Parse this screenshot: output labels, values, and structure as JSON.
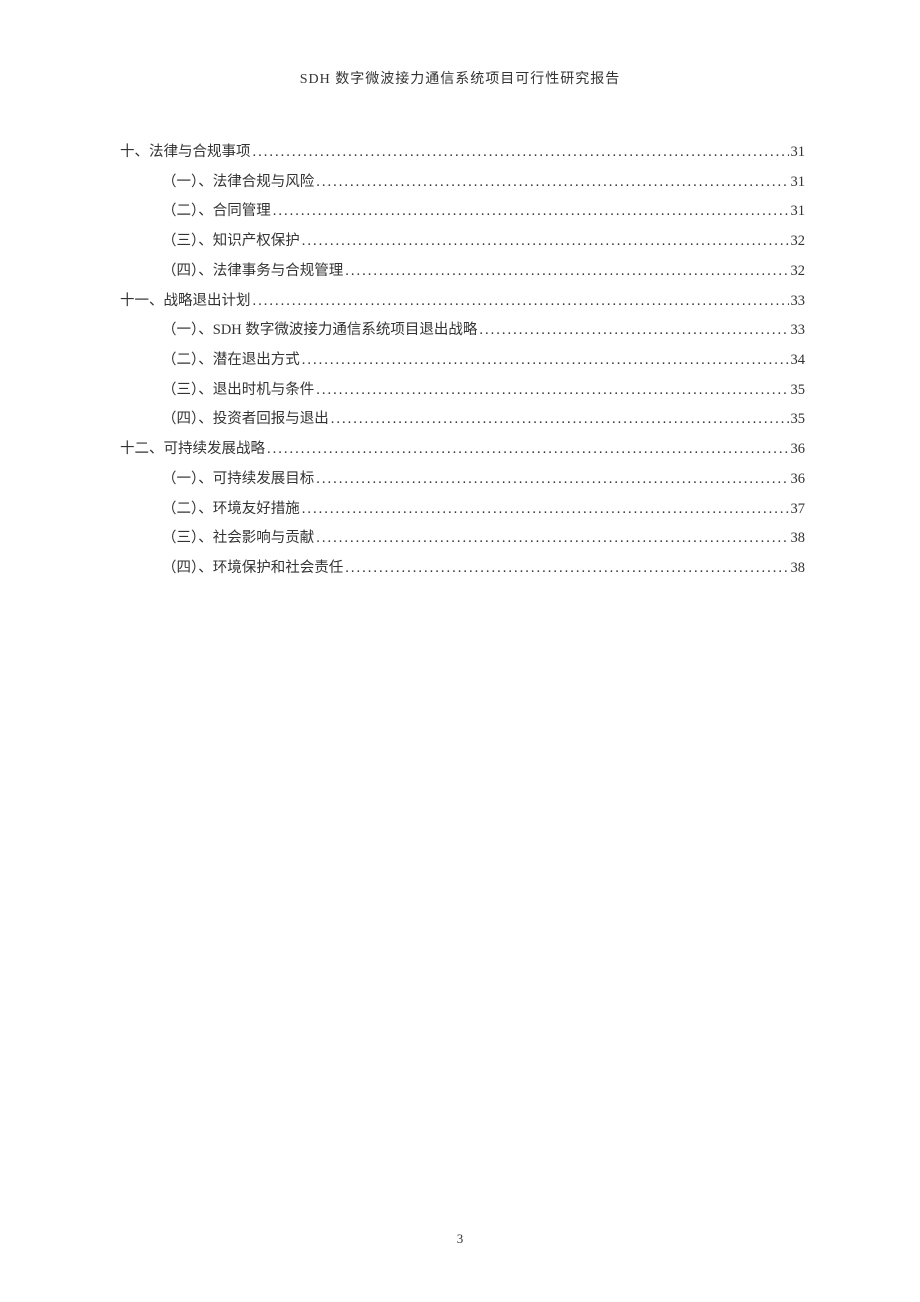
{
  "header": {
    "title": "SDH 数字微波接力通信系统项目可行性研究报告"
  },
  "toc": [
    {
      "level": 1,
      "label": "十、法律与合规事项",
      "page": "31"
    },
    {
      "level": 2,
      "label": "（一）、法律合规与风险",
      "page": "31"
    },
    {
      "level": 2,
      "label": "（二）、合同管理",
      "page": "31"
    },
    {
      "level": 2,
      "label": "（三）、知识产权保护",
      "page": "32"
    },
    {
      "level": 2,
      "label": "（四）、法律事务与合规管理",
      "page": "32"
    },
    {
      "level": 1,
      "label": "十一、战略退出计划",
      "page": "33"
    },
    {
      "level": 2,
      "label": "（一）、SDH 数字微波接力通信系统项目退出战略",
      "page": "33"
    },
    {
      "level": 2,
      "label": "（二）、潜在退出方式",
      "page": "34"
    },
    {
      "level": 2,
      "label": "（三）、退出时机与条件",
      "page": "35"
    },
    {
      "level": 2,
      "label": "（四）、投资者回报与退出",
      "page": "35"
    },
    {
      "level": 1,
      "label": "十二、可持续发展战略",
      "page": "36"
    },
    {
      "level": 2,
      "label": "（一）、可持续发展目标",
      "page": "36"
    },
    {
      "level": 2,
      "label": "（二）、环境友好措施",
      "page": "37"
    },
    {
      "level": 2,
      "label": "（三）、社会影响与贡献",
      "page": "38"
    },
    {
      "level": 2,
      "label": "（四）、环境保护和社会责任",
      "page": "38"
    }
  ],
  "footer": {
    "page_number": "3"
  }
}
